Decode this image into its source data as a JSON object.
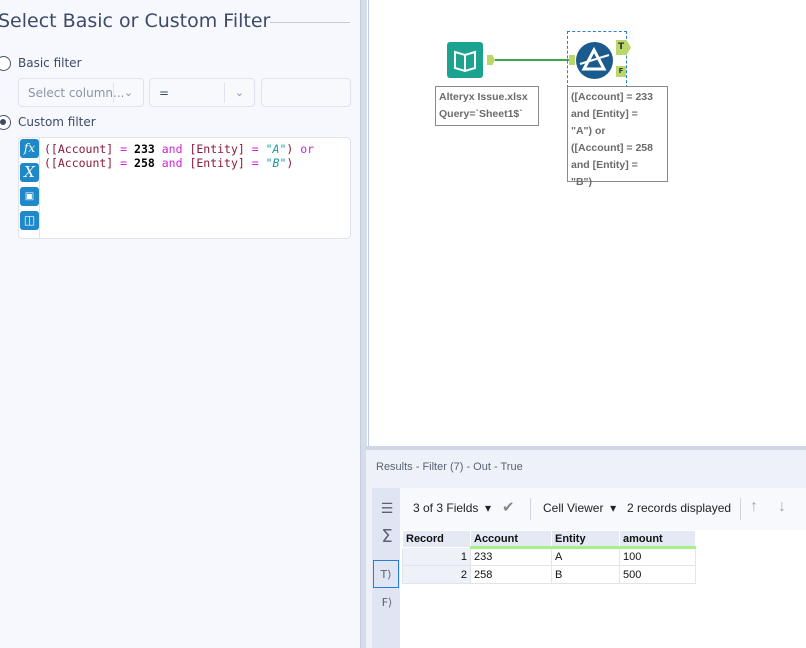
{
  "config": {
    "title": "Select Basic or Custom Filter",
    "basic_label": "Basic filter",
    "custom_label": "Custom filter",
    "mode": "custom",
    "column_placeholder": "Select column...",
    "operator": "=",
    "value": "",
    "expression_lines": [
      [
        [
          "br",
          "([Account]"
        ],
        [
          "op",
          " = "
        ],
        [
          "num",
          "233"
        ],
        [
          "op",
          " and "
        ],
        [
          "br",
          "[Entity]"
        ],
        [
          "op",
          " = "
        ],
        [
          "str",
          "\"A\""
        ],
        [
          "br",
          ")"
        ],
        [
          "op",
          " or"
        ]
      ],
      [
        [
          "br",
          "([Account]"
        ],
        [
          "op",
          " = "
        ],
        [
          "num",
          "258"
        ],
        [
          "op",
          " and "
        ],
        [
          "br",
          "[Entity]"
        ],
        [
          "op",
          " = "
        ],
        [
          "str",
          "\"B\""
        ],
        [
          "br",
          ")"
        ]
      ]
    ],
    "editor_icons": [
      "fx-icon",
      "variable-icon",
      "open-folder-icon",
      "save-icon"
    ]
  },
  "canvas": {
    "input_tool": {
      "annotation_line1": "Alteryx Issue.xlsx",
      "annotation_line2": "Query=`Sheet1$`"
    },
    "filter_tool": {
      "true_anchor": "T",
      "false_anchor": "F",
      "annotation_lines": [
        "([Account] = 233",
        "and [Entity] =",
        "\"A\") or",
        "([Account] = 258",
        "and [Entity] =",
        "\"B\")"
      ]
    },
    "colors": {
      "input": "#1ba38f",
      "filter": "#1b5a8c",
      "connection": "#3fa64a",
      "anchor": "#b9d86b"
    }
  },
  "results": {
    "header": "Results - Filter (7) - Out - True",
    "fields": "3 of 3 Fields",
    "viewer": "Cell Viewer",
    "records": "2 records displayed",
    "columns": [
      "Record",
      "Account",
      "Entity",
      "amount"
    ],
    "rows": [
      [
        "1",
        "233",
        "A",
        "100"
      ],
      [
        "2",
        "258",
        "B",
        "500"
      ]
    ],
    "side_tabs": [
      "T",
      "F"
    ]
  }
}
